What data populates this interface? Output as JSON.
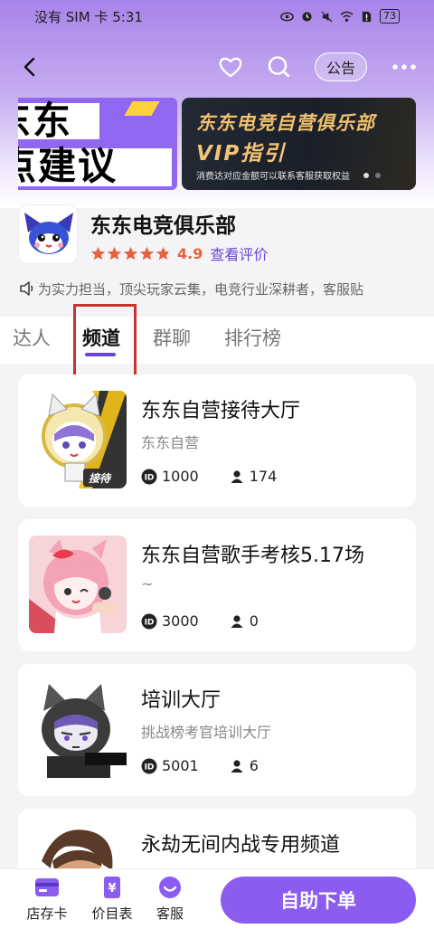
{
  "status_bar": {
    "carrier": "没有 SIM 卡",
    "time": "5:31",
    "battery": "73"
  },
  "nav": {
    "notice_label": "公告"
  },
  "banner": {
    "left_line1": "东东",
    "left_line2": "点建议",
    "right_title": "东东电竞自营俱乐部",
    "right_subtitle": "VIP指引",
    "right_note": "消费达对应金额可以联系客服获取权益"
  },
  "store": {
    "name": "东东电竞俱乐部",
    "rating": "4.9",
    "stars": 4.9,
    "review_link": "查看评价",
    "notice": "为实力担当，顶尖玩家云集，电竞行业深耕者，客服贴"
  },
  "tabs": [
    {
      "label": "达人",
      "active": false
    },
    {
      "label": "频道",
      "active": true
    },
    {
      "label": "群聊",
      "active": false
    },
    {
      "label": "排行榜",
      "active": false
    }
  ],
  "channels": [
    {
      "title": "东东自营接待大厅",
      "subtitle": "东东自营",
      "id": "1000",
      "members": "174",
      "badge": "接待"
    },
    {
      "title": "东东自营歌手考核5.17场",
      "subtitle": "~",
      "id": "3000",
      "members": "0"
    },
    {
      "title": "培训大厅",
      "subtitle": "挑战榜考官培训大厅",
      "id": "5001",
      "members": "6"
    },
    {
      "title": "永劫无间内战专用频道",
      "subtitle": "",
      "id": "",
      "members": ""
    }
  ],
  "bottom": {
    "store_card": "店存卡",
    "price_list": "价目表",
    "service": "客服",
    "order_button": "自助下单"
  },
  "colors": {
    "accent": "#8a5cf0",
    "rating": "#e6623d",
    "highlight": "#c8332f"
  }
}
